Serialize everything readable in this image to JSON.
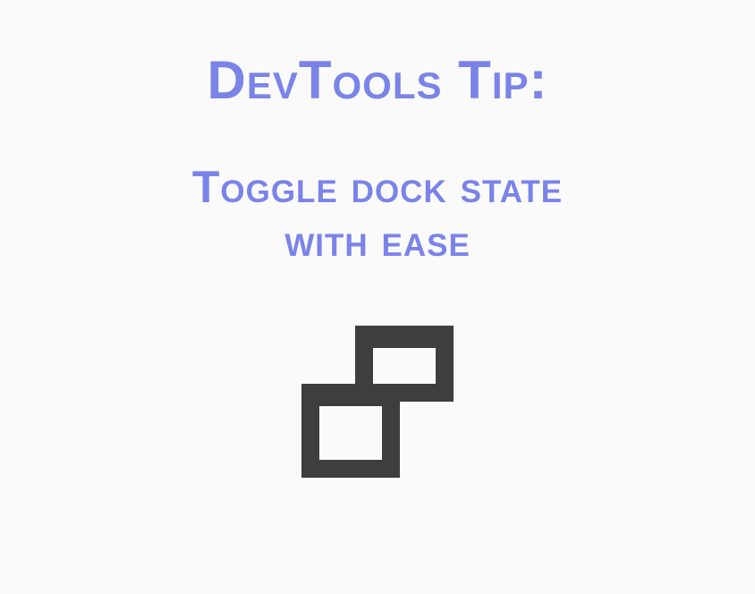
{
  "title": "DevTools Tip:",
  "subtitle_line1": "Toggle dock state",
  "subtitle_line2": "with ease",
  "colors": {
    "text": "#7a84e8",
    "icon": "#3e3e3e",
    "background": "#fafafa"
  }
}
